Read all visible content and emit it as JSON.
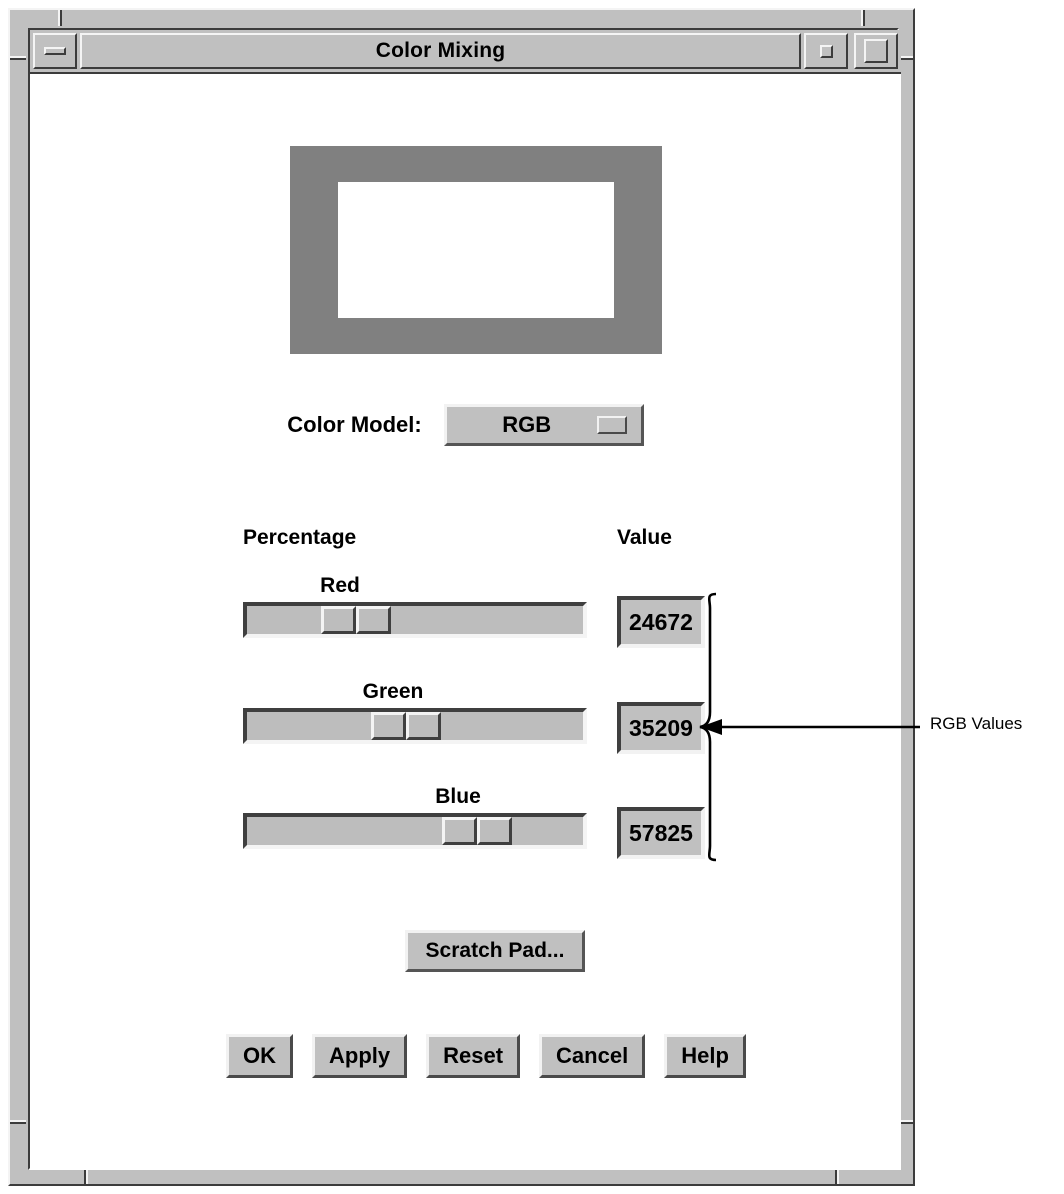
{
  "window": {
    "title": "Color Mixing",
    "buttons": {
      "minimize": "minimize",
      "restore": "restore",
      "maximize": "maximize"
    }
  },
  "dialog": {
    "swatch": {
      "outer_color": "#808080",
      "inner_color": "#ffffff"
    },
    "color_model": {
      "label": "Color Model:",
      "value": "RGB"
    },
    "headers": {
      "percentage": "Percentage",
      "value": "Value"
    },
    "channels": [
      {
        "label": "Red",
        "value": "24672",
        "percent": 22
      },
      {
        "label": "Green",
        "value": "35209",
        "percent": 37
      },
      {
        "label": "Blue",
        "value": "57825",
        "percent": 58
      }
    ],
    "scratch_pad_label": "Scratch Pad...",
    "actions": [
      {
        "label": "OK"
      },
      {
        "label": "Apply"
      },
      {
        "label": "Reset"
      },
      {
        "label": "Cancel"
      },
      {
        "label": "Help"
      }
    ]
  },
  "annotation": {
    "text": "RGB Values"
  }
}
